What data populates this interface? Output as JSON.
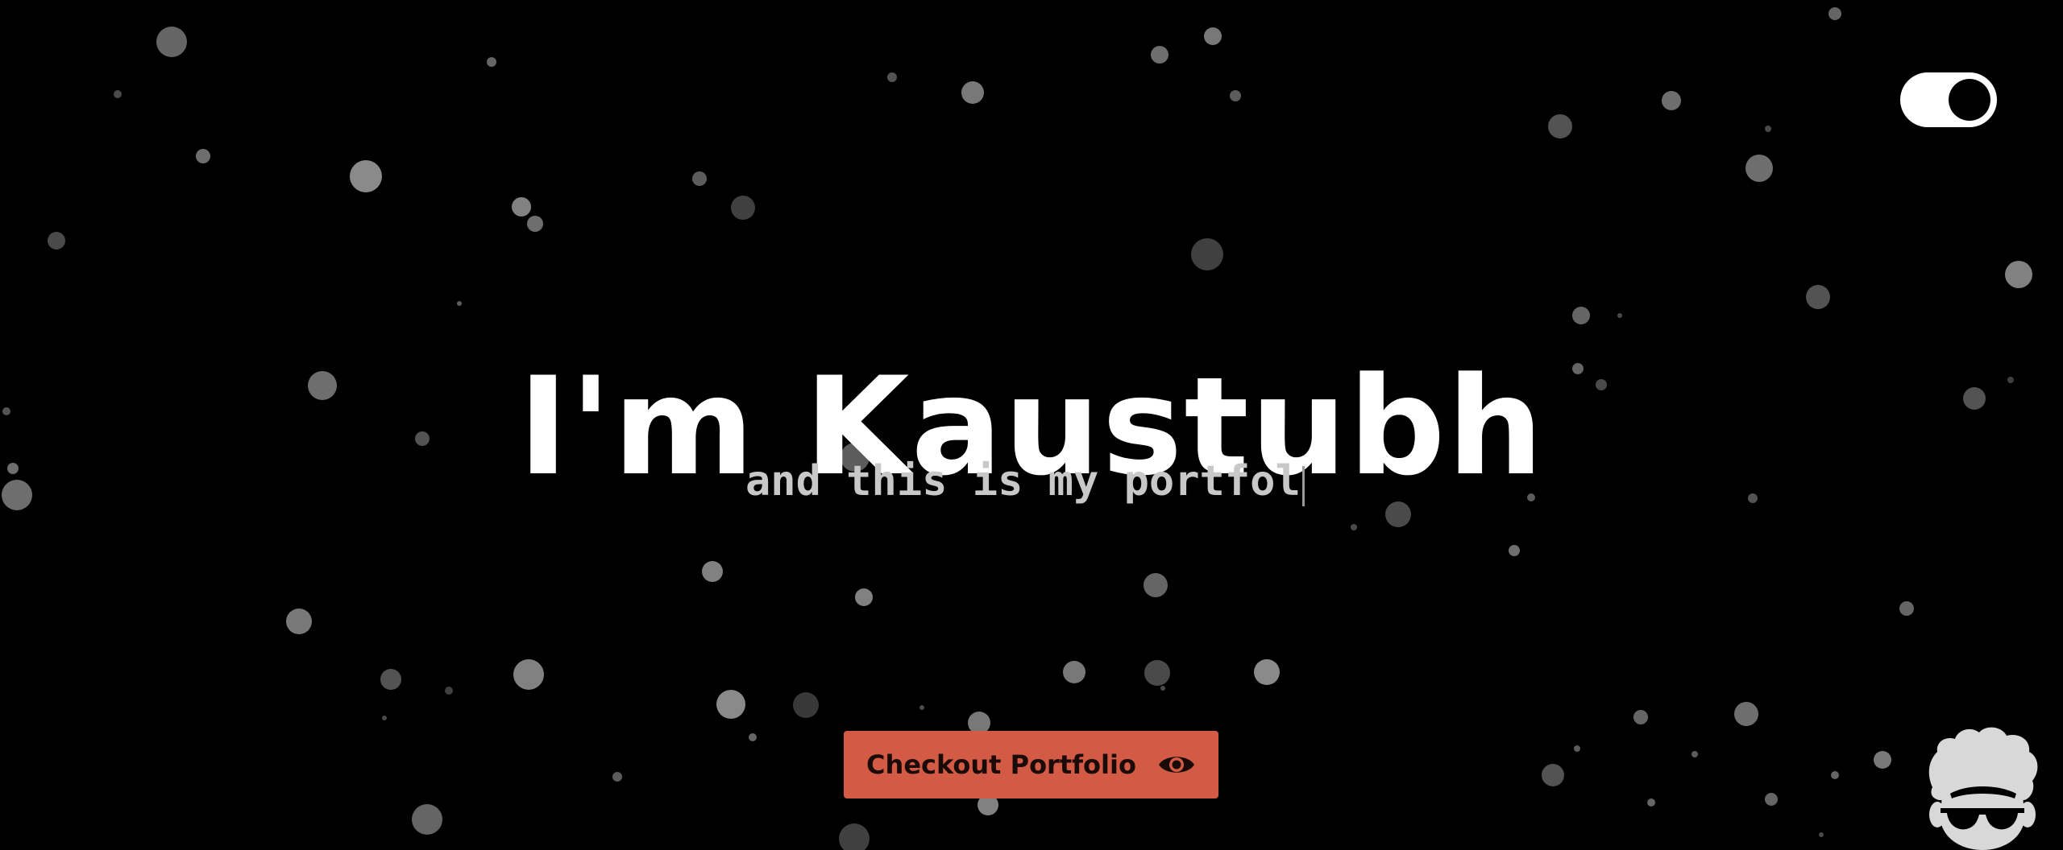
{
  "hero": {
    "title": "I'm Kaustubh",
    "subtitle": "and this is my portfol"
  },
  "cta": {
    "label": "Checkout Portfolio",
    "icon": "eye-icon"
  },
  "theme_toggle": {
    "state": "dark",
    "icon": "toggle-switch"
  },
  "avatar": {
    "icon": "avatar-sunglasses-icon"
  },
  "colors": {
    "background": "#000000",
    "title": "#ffffff",
    "subtitle": "#c8c8c8",
    "cta_background": "#d35a45",
    "cta_text": "#1a0a08",
    "particle_light": "#8a8a8a",
    "particle_dark": "#3a3a3a"
  }
}
